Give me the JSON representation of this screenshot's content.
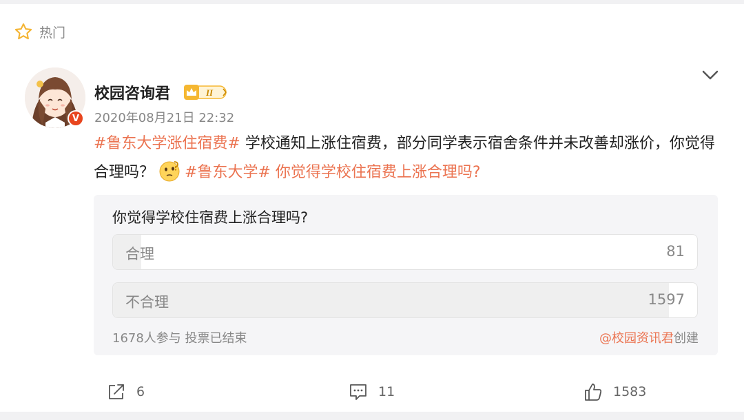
{
  "header": {
    "label": "热门",
    "icon": "star-icon"
  },
  "post": {
    "author": {
      "name": "校园咨询君",
      "verified_mark": "V",
      "vip_level": "II",
      "avatar_icon": "anime-girl-avatar"
    },
    "timestamp": "2020年08月21日 22:32",
    "text": {
      "hashtag1": "#鲁东大学涨住宿费#",
      "body": " 学校通知上涨住宿费，部分同学表示宿舍条件并未改善却涨价，你觉得合理吗？",
      "emoji": "thinking-face-emoji",
      "hashtag2": "#鲁东大学#",
      "tail": " 你觉得学校住宿费上涨合理吗?"
    }
  },
  "poll": {
    "question": "你觉得学校住宿费上涨合理吗?",
    "options": [
      {
        "label": "合理",
        "count": "81",
        "fraction": 0.048
      },
      {
        "label": "不合理",
        "count": "1597",
        "fraction": 0.952
      }
    ],
    "footer_status": "1678人参与 投票已结束",
    "creator_mention": "@校园资讯君",
    "creator_suffix": "创建"
  },
  "actions": {
    "share": {
      "icon": "share-icon",
      "count": "6"
    },
    "comment": {
      "icon": "comment-icon",
      "count": "11"
    },
    "like": {
      "icon": "thumbs-up-icon",
      "count": "1583"
    }
  },
  "colors": {
    "accent": "#eb7350",
    "vip_gold": "#f5b731",
    "verified_red": "#e8451e"
  }
}
